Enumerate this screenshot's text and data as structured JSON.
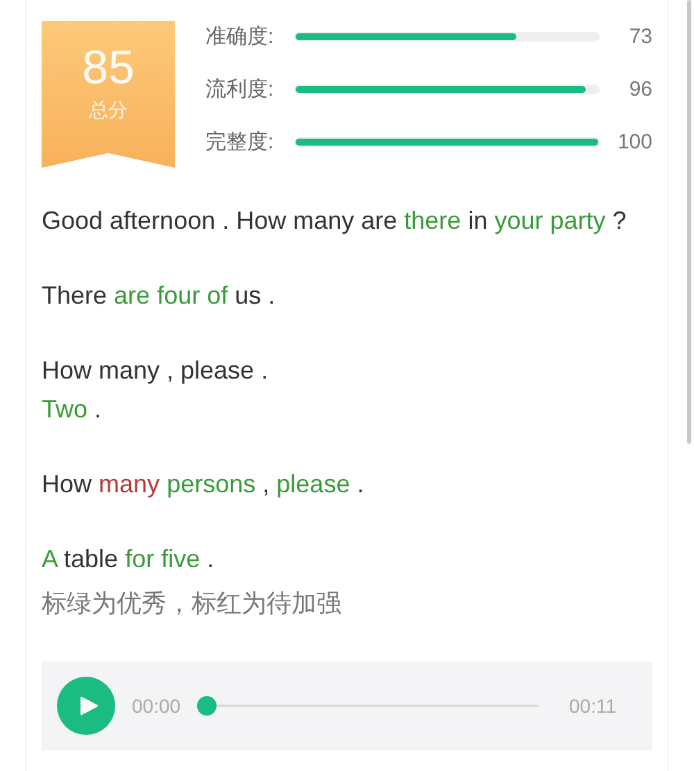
{
  "score": {
    "value": "85",
    "label": "总分"
  },
  "metrics": [
    {
      "label": "准确度:",
      "level": 0.73,
      "value": "73"
    },
    {
      "label": "流利度:",
      "level": 0.96,
      "value": "96"
    },
    {
      "label": "完整度:",
      "level": 1,
      "value": "100"
    }
  ],
  "paragraphs": [
    {
      "lines": [
        [
          {
            "text": "Good afternoon . How many are",
            "color": "#333333"
          },
          {
            "text": "there",
            "color": "#3a9a3a"
          },
          {
            "text": "in",
            "color": "#333333"
          },
          {
            "text": "your party",
            "color": "#3a9a3a"
          },
          {
            "text": "?",
            "color": "#333333"
          }
        ]
      ]
    },
    {
      "lines": [
        [
          {
            "text": "There",
            "color": "#333333"
          },
          {
            "text": "are four of",
            "color": "#3a9a3a"
          },
          {
            "text": "us .",
            "color": "#333333"
          }
        ]
      ]
    },
    {
      "lines": [
        [
          {
            "text": "How many , please .",
            "color": "#333333"
          }
        ],
        [
          {
            "text": "Two",
            "color": "#3a9a3a"
          },
          {
            "text": ".",
            "color": "#333333"
          }
        ]
      ]
    },
    {
      "lines": [
        [
          {
            "text": "How",
            "color": "#333333"
          },
          {
            "text": "many",
            "color": "#b53a3a"
          },
          {
            "text": "persons",
            "color": "#3a9a3a"
          },
          {
            "text": ",",
            "color": "#333333"
          },
          {
            "text": "please",
            "color": "#3a9a3a"
          },
          {
            "text": ".",
            "color": "#333333"
          }
        ]
      ]
    },
    {
      "lines": [
        [
          {
            "text": "A",
            "color": "#3a9a3a"
          },
          {
            "text": "table",
            "color": "#333333"
          },
          {
            "text": "for five",
            "color": "#3a9a3a"
          },
          {
            "text": ".",
            "color": "#333333"
          }
        ]
      ]
    }
  ],
  "hint": "标绿为优秀，标红为待加强",
  "player": {
    "current": "00:00",
    "level": 0,
    "total": "00:11"
  }
}
